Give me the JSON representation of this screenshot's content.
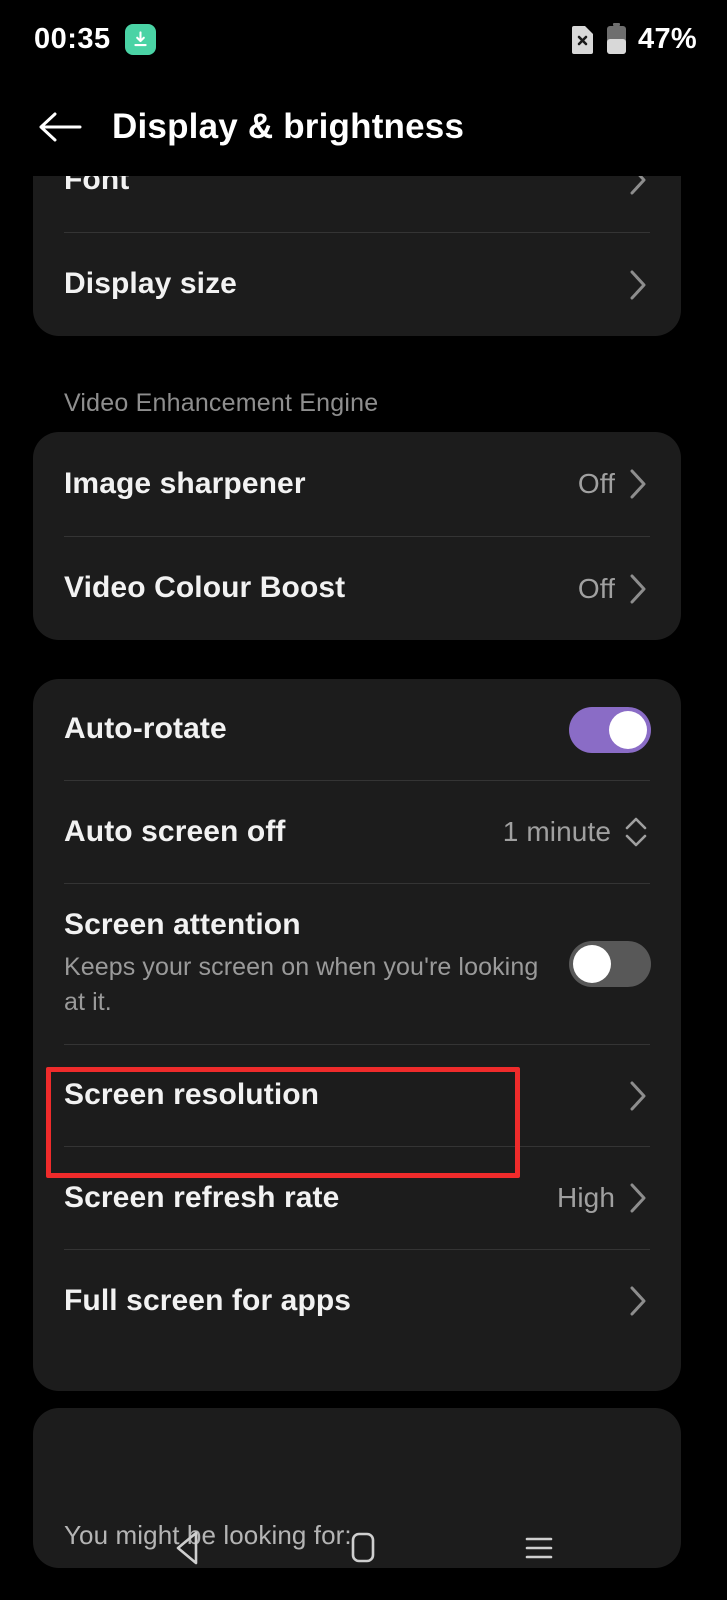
{
  "status_bar": {
    "time": "00:35",
    "download_badge_icon": "download-icon",
    "badge_color": "#4ad3a5",
    "sim_icon": "sim-card-off-icon",
    "battery_icon": "battery-icon",
    "battery_text": "47%"
  },
  "app_bar": {
    "back_icon": "arrow-left-icon",
    "title": "Display & brightness"
  },
  "cards": {
    "card1": {
      "rows": [
        {
          "title": "Font",
          "value": "",
          "accessory": "chevron-right-icon"
        },
        {
          "title": "Display size",
          "value": "",
          "accessory": "chevron-right-icon"
        }
      ]
    },
    "video_section": {
      "label": "Video Enhancement Engine",
      "rows": [
        {
          "title": "Image sharpener",
          "value": "Off",
          "accessory": "chevron-right-icon"
        },
        {
          "title": "Video Colour Boost",
          "value": "Off",
          "accessory": "chevron-right-icon"
        }
      ]
    },
    "card3": {
      "rows": [
        {
          "title": "Auto-rotate",
          "value": "",
          "accessory": "toggle-on"
        },
        {
          "title": "Auto screen off",
          "value": "1 minute",
          "accessory": "stepper-icon"
        },
        {
          "title": "Screen attention",
          "subtitle": "Keeps your screen on when you're looking at it.",
          "value": "",
          "accessory": "toggle-off"
        },
        {
          "title": "Screen resolution",
          "value": "",
          "accessory": "chevron-right-icon"
        },
        {
          "title": "Screen refresh rate",
          "value": "High",
          "accessory": "chevron-right-icon"
        },
        {
          "title": "Full screen for apps",
          "value": "",
          "accessory": "chevron-right-icon"
        }
      ]
    },
    "card4": {
      "heading": "You might be looking for:"
    }
  },
  "highlight": {
    "color": "#ef2b2b",
    "target": "Screen resolution"
  },
  "nav_bar": {
    "back_icon": "nav-back-triangle-icon",
    "home_icon": "nav-home-square-icon",
    "recents_icon": "nav-recents-lines-icon"
  }
}
